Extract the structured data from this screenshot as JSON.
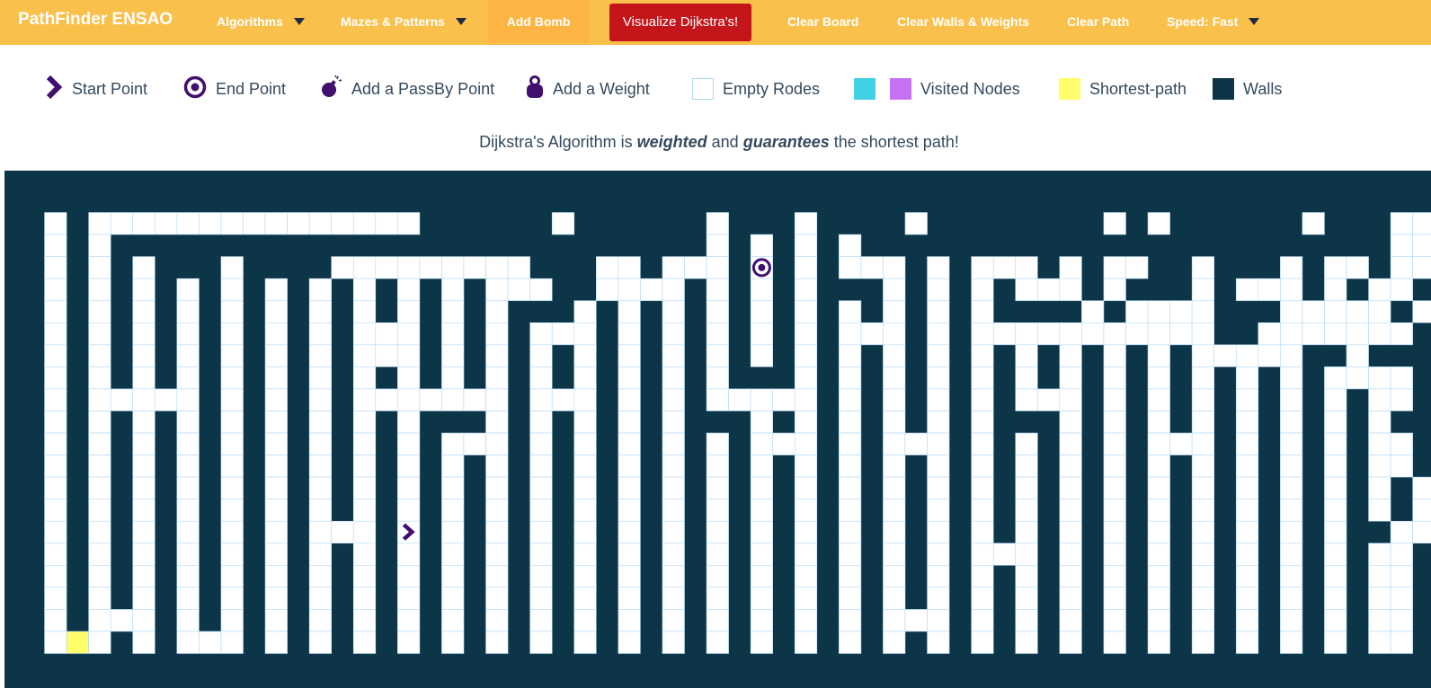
{
  "navbar": {
    "brand": "PathFinder ENSAO",
    "algorithms": "Algorithms",
    "mazes": "Mazes & Patterns",
    "add_bomb": "Add Bomb",
    "visualize": "Visualize Dijkstra's!",
    "clear_board": "Clear Board",
    "clear_walls": "Clear Walls & Weights",
    "clear_path": "Clear Path",
    "speed": "Speed: Fast"
  },
  "legend": {
    "start": "Start Point",
    "end": "End Point",
    "passby": "Add a PassBy Point",
    "weight": "Add a Weight",
    "empty": "Empty Rodes",
    "visited": "Visited Nodes",
    "shortest": "Shortest-path",
    "walls": "Walls"
  },
  "info": {
    "prefix": "Dijkstra's Algorithm is ",
    "weighted": "weighted",
    "middle": " and ",
    "guarantees": "guarantees",
    "suffix": " the shortest path!"
  },
  "colors": {
    "nav_bg": "#f9c04c",
    "visualize_bg": "#c4151b",
    "wall": "#0c3547",
    "visited_cyan": "#41d1e4",
    "visited_purple": "#c471f5",
    "visited_front": "#4a86d8",
    "shortest_path": "#fffe6a",
    "icon_purple": "#41106e"
  },
  "icons": {
    "start": "chevron-right-icon",
    "end": "target-icon",
    "passby": "bomb-icon",
    "weight": "weight-icon"
  },
  "board": {
    "rows": 21,
    "cols": 64,
    "start": [
      15,
      17
    ],
    "end": [
      3,
      33
    ],
    "grid": [
      "################################################################",
      "#.#...............######.######.###.####.########.#.######.###..",
      "#.#.###########################.#.#.#.########################..",
      "#.#.#.###.####.........###..#...#.#e#...#.#...#.#..##.###.#..#..",
      "#.#.#.#.#.#.#.#.#.#.#...##....#.#.#.###.#.#.#...#.###.#...#.#..#",
      "#.#.#.#.#.#.#.#.#.#.#.###.#.#.#.#.#.#.#.#.#.####.#....###.....#.",
      "#.#.#.#.#.#.#.#...#.#.#...#.#.#.#.#.#...#.#...........##.......#",
      "#.#.#.#.#.#.#.#...#.#.#.#.#.#.#.#.#.#.#.#.#.#.#.#.#.#.....##.###",
      "#.#.#.#.#.#.#.#.#.#.#.#.#.#.#.#.###.#.#.#.#.#.#.#.#.#.#.#.#....#",
      "#.#.....#.#.#.#.......#...#.#.#.....#.#.#.#.#...#.#.#.#.#.#.#..#",
      "#.#.#.#.#.#.#.#.#.###.#.#.#.#.###.#.#.#.#.#.###.#.#.#.#.#.#.#.##",
      "#.#.#.#.#.#.#.#.#.#...#.#.#.#.#.#...#.#...#.#.#.#.#...#.#.#.#..#",
      "#.#.#.#.#.#.#.#.#.#.#.#.#.#.#.#.#.#.#.#.#.#.#.#.#.#.#.#.#.#.#..#",
      "#.#.#.#.#.#.#.#.#.#.#.#.#.#.#.#.#.#.#.#.#.#.#.#.#.#.#.#.#.#.#.#.",
      "#.#.#.#.#.#.#.#.#.#.#.#.#.#.#.#.#.#.#.#.#.#.#.#.#.#.#.#.#.#.#.#.",
      "#.#.#.#.#.#.#...#.#.#.#.#.#.#.#.#.#.#.#.#.#.#.#.#.#.#.#.#.#.##..",
      "#.#.#.#.#.#.#.#.#.#.#.#.#.#.#.#.#.#.#.#.#.#...#.#.#.#.#.#.#.#..#",
      "#.#.#.#.#.#.#.#.#.#.#.#.#.#.#.#.#.#.#.#.#.#.#.#.#.#.#.#.#.#.#..#",
      "#.#.#.#.#.#.#.#.#.#.#.#.#.#.#.#.#.#.#.#.#.#.#.#.#.#.#.#.#.#.#..#",
      "#.#...#.#.#.#.#.#.#.#.#.#.#.#.#.#.#.#.#...#.#.#.#.#.#.#.#.#.#..#",
      "#.#.#.#...#.#.#.#.#.#.#.#.#.#.#.#.#.#.#.#.#.#.#.#.#.#.#.#.#.#..#"
    ],
    "shortest_path_cells": [
      [
        20,
        2
      ]
    ],
    "passby_points": [],
    "weight_points": []
  }
}
